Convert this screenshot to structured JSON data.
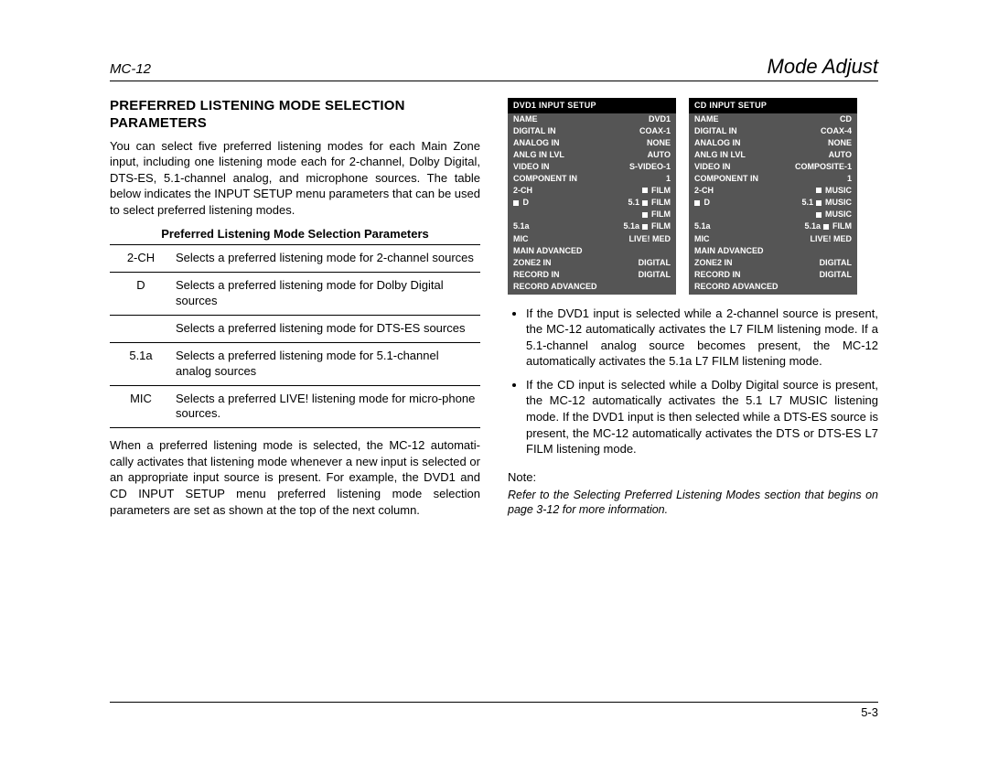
{
  "header": {
    "left": "MC-12",
    "right": "Mode Adjust"
  },
  "section_title": "PREFERRED LISTENING MODE SELECTION PARAMETERS",
  "intro": "You can select five preferred listening modes for each Main Zone input, including one listening mode each for 2-channel, Dolby Digital, DTS-ES, 5.1-channel analog, and microphone sources. The table below indicates the INPUT SETUP menu parameters that can be used to select preferred listening modes.",
  "table": {
    "caption": "Preferred Listening Mode Selection Parameters",
    "rows": [
      {
        "k": "2-CH",
        "v": "Selects a preferred listening mode for 2-channel sources"
      },
      {
        "k": "D",
        "v": "Selects a preferred listening mode for Dolby Digital sources"
      },
      {
        "k": "",
        "v": "Selects a preferred listening mode for DTS-ES sources"
      },
      {
        "k": "5.1a",
        "v": "Selects a preferred listening mode for 5.1-channel analog sources"
      },
      {
        "k": "MIC",
        "v": "Selects a preferred LIVE! listening mode for micro-phone sources."
      }
    ]
  },
  "after_table": "When a preferred listening mode is selected, the MC-12 automati-cally activates that listening mode whenever a new input is selected or an appropriate input source is present. For example, the DVD1 and CD INPUT SETUP menu preferred listening mode selection parameters are set as shown at the top of the next column.",
  "menus": [
    {
      "title": "DVD1 INPUT SETUP",
      "rows": [
        [
          "NAME",
          "DVD1"
        ],
        [
          "DIGITAL IN",
          "COAX-1"
        ],
        [
          "ANALOG IN",
          "NONE"
        ],
        [
          "ANLG IN LVL",
          "AUTO"
        ],
        [
          "VIDEO IN",
          "S-VIDEO-1"
        ],
        [
          "COMPONENT IN",
          "1"
        ],
        [
          "2-CH",
          "■ FILM"
        ],
        [
          "■ D",
          "5.1 ■ FILM"
        ],
        [
          "",
          "■ FILM"
        ],
        [
          "5.1a",
          "5.1a ■ FILM"
        ],
        [
          "MIC",
          "LIVE! MED"
        ],
        [
          "MAIN ADVANCED",
          ""
        ],
        [
          "ZONE2 IN",
          "DIGITAL"
        ],
        [
          "RECORD IN",
          "DIGITAL"
        ],
        [
          "RECORD ADVANCED",
          ""
        ]
      ]
    },
    {
      "title": "CD INPUT SETUP",
      "rows": [
        [
          "NAME",
          "CD"
        ],
        [
          "DIGITAL IN",
          "COAX-4"
        ],
        [
          "ANALOG IN",
          "NONE"
        ],
        [
          "ANLG IN LVL",
          "AUTO"
        ],
        [
          "VIDEO IN",
          "COMPOSITE-1"
        ],
        [
          "COMPONENT IN",
          "1"
        ],
        [
          "2-CH",
          "■ MUSIC"
        ],
        [
          "■ D",
          "5.1 ■ MUSIC"
        ],
        [
          "",
          "■ MUSIC"
        ],
        [
          "5.1a",
          "5.1a ■ FILM"
        ],
        [
          "MIC",
          "LIVE! MED"
        ],
        [
          "MAIN ADVANCED",
          ""
        ],
        [
          "ZONE2 IN",
          "DIGITAL"
        ],
        [
          "RECORD IN",
          "DIGITAL"
        ],
        [
          "RECORD ADVANCED",
          ""
        ]
      ]
    }
  ],
  "bullets": [
    "If the DVD1 input is selected while a 2-channel source is present, the MC-12 automatically activates the L7 FILM listening mode. If a 5.1-channel analog source becomes present, the MC-12 automatically activates the 5.1a L7 FILM listening mode.",
    "If the CD input is selected while a Dolby Digital source is present, the MC-12 automatically activates the 5.1 L7 MUSIC listening mode. If the DVD1 input is then selected while a DTS-ES source is present, the MC-12 automatically activates the DTS or DTS-ES L7 FILM listening mode."
  ],
  "note_label": "Note:",
  "note_body": "Refer to the Selecting Preferred Listening Modes section that begins on page 3-12 for more information.",
  "page_num": "5-3"
}
